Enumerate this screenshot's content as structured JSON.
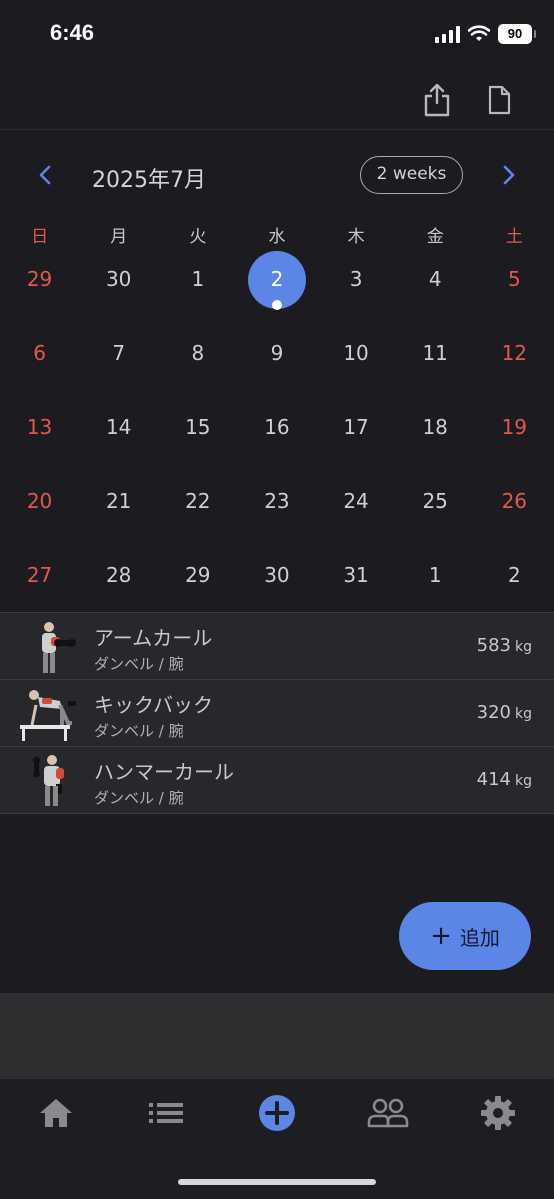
{
  "status_bar": {
    "time": "6:46",
    "battery": "90"
  },
  "toolbar": {
    "share_icon": "share-icon",
    "document_icon": "document-icon"
  },
  "calendar": {
    "month_label": "2025年7月",
    "range_toggle": "2 weeks",
    "weekdays": [
      "日",
      "月",
      "火",
      "水",
      "木",
      "金",
      "土"
    ],
    "weeks": [
      [
        "29",
        "30",
        "1",
        "2",
        "3",
        "4",
        "5"
      ],
      [
        "6",
        "7",
        "8",
        "9",
        "10",
        "11",
        "12"
      ],
      [
        "13",
        "14",
        "15",
        "16",
        "17",
        "18",
        "19"
      ],
      [
        "20",
        "21",
        "22",
        "23",
        "24",
        "25",
        "26"
      ],
      [
        "27",
        "28",
        "29",
        "30",
        "31",
        "1",
        "2"
      ]
    ],
    "selected_day": "2",
    "accent_color": "#5b86e5",
    "weekend_color": "#e0584f"
  },
  "exercises": [
    {
      "name": "アームカール",
      "category": "ダンベル / 腕",
      "weight": "583",
      "unit": "kg"
    },
    {
      "name": "キックバック",
      "category": "ダンベル / 腕",
      "weight": "320",
      "unit": "kg"
    },
    {
      "name": "ハンマーカール",
      "category": "ダンベル / 腕",
      "weight": "414",
      "unit": "kg"
    }
  ],
  "fab": {
    "plus": "+",
    "label": "追加"
  },
  "tabbar": [
    "home-icon",
    "list-icon",
    "add-circle-icon",
    "users-icon",
    "gear-icon"
  ]
}
